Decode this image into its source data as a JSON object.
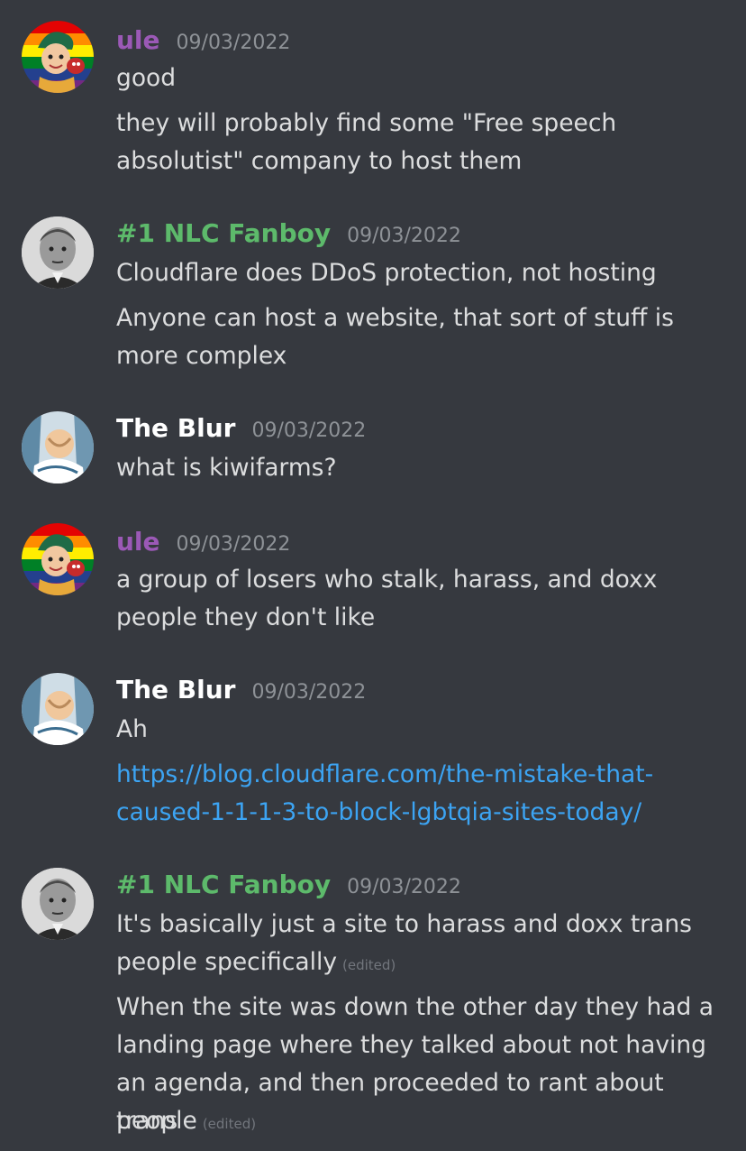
{
  "colors": {
    "background": "#36393f",
    "text": "#dcddde",
    "timestamp": "#8e9297",
    "link": "#3ca4f3",
    "author_ule": "#9b59b6",
    "author_fanboy": "#5dba6b",
    "author_blur": "#ffffff"
  },
  "messages": [
    {
      "author": "ule",
      "timestamp": "09/03/2022",
      "lines": [
        "good",
        "they will probably find some \"Free speech",
        "absolutist\" company to host them"
      ]
    },
    {
      "author": "#1 NLC Fanboy",
      "timestamp": "09/03/2022",
      "lines": [
        "Cloudflare does DDoS protection, not hosting",
        "Anyone can host a website, that sort of stuff is",
        "more complex"
      ]
    },
    {
      "author": "The Blur",
      "timestamp": "09/03/2022",
      "lines": [
        "what is kiwifarms?"
      ]
    },
    {
      "author": "ule",
      "timestamp": "09/03/2022",
      "lines": [
        "a group of losers who stalk, harass, and doxx",
        "people they don't like"
      ]
    },
    {
      "author": "The Blur",
      "timestamp": "09/03/2022",
      "lines": [
        "Ah"
      ],
      "link_lines": [
        "https://blog.cloudflare.com/the-mistake-that-",
        "caused-1-1-1-3-to-block-lgbtqia-sites-today/"
      ]
    },
    {
      "author": "#1 NLC Fanboy",
      "timestamp": "09/03/2022",
      "lines": [
        "It's basically just a site to harass and doxx trans",
        "people specifically",
        "When the site was down the other day they had a",
        "landing page where they talked about not having",
        "an agenda, and then proceeded to rant about trans",
        "people"
      ],
      "edited_label": "(edited)"
    }
  ]
}
